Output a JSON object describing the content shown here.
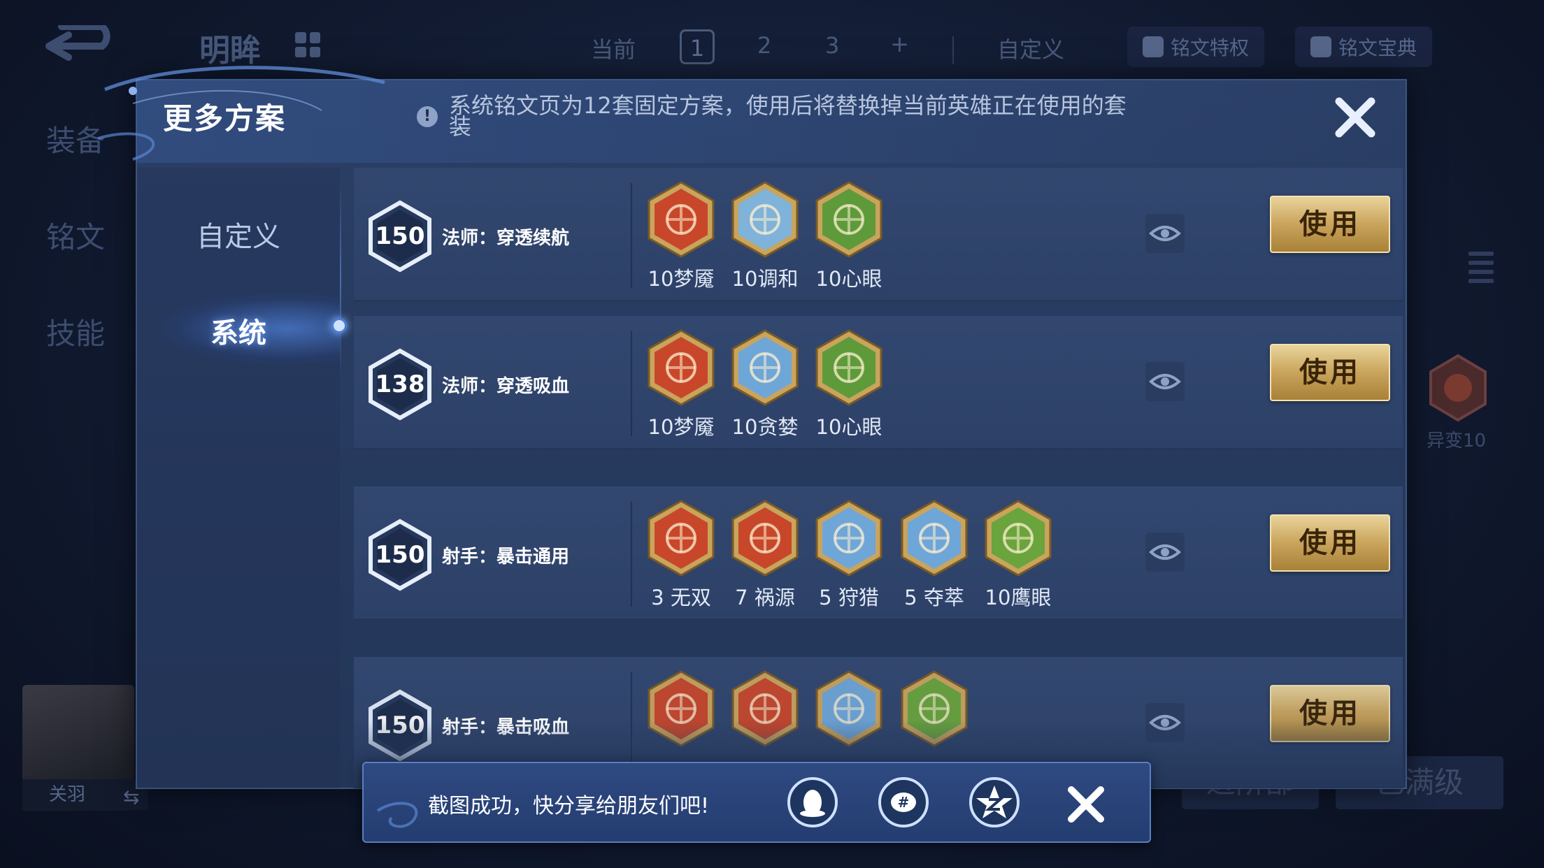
{
  "background": {
    "hero_title": "明眸",
    "current_label": "当前",
    "pages": [
      "1",
      "2",
      "3"
    ],
    "add_page": "+",
    "custom_label": "自定义",
    "rune_privilege": "铭文特权",
    "rune_codex": "铭文宝典",
    "side_tabs": [
      "装备",
      "铭文",
      "技能"
    ],
    "hero_name": "关羽",
    "bg_rune_label": "异变10",
    "bg_button_1": "进阶部",
    "bg_button_2": "已满级"
  },
  "dialog": {
    "title": "更多方案",
    "notice": "系统铭文页为12套固定方案，使用后将替换掉当前英雄正在使用的套装",
    "tabs": {
      "custom": "自定义",
      "system": "系统"
    }
  },
  "presets": [
    {
      "level": "150",
      "name": "法师：穿透续航",
      "runes": [
        {
          "label": "10梦魇",
          "color": "#c8472a",
          "icon": "red-demon-rune"
        },
        {
          "label": "10调和",
          "color": "#7fb3d9",
          "icon": "blue-drop-rune"
        },
        {
          "label": "10心眼",
          "color": "#5e9a3a",
          "icon": "green-shield-rune"
        }
      ],
      "button": "使用"
    },
    {
      "level": "138",
      "name": "法师：穿透吸血",
      "runes": [
        {
          "label": "10梦魇",
          "color": "#c8472a",
          "icon": "red-demon-rune"
        },
        {
          "label": "10贪婪",
          "color": "#6fa6d8",
          "icon": "blue-star-rune"
        },
        {
          "label": "10心眼",
          "color": "#5e9a3a",
          "icon": "green-shield-rune"
        }
      ],
      "button": "使用"
    },
    {
      "level": "150",
      "name": "射手：暴击通用",
      "runes": [
        {
          "label": "3 无双",
          "color": "#c8472a",
          "icon": "red-spiral-rune"
        },
        {
          "label": "7 祸源",
          "color": "#c8472a",
          "icon": "red-fan-rune"
        },
        {
          "label": "5 狩猎",
          "color": "#6fa6d8",
          "icon": "blue-lightning-rune"
        },
        {
          "label": "5 夺萃",
          "color": "#6fa6d8",
          "icon": "blue-knot-rune"
        },
        {
          "label": "10鹰眼",
          "color": "#6aa43c",
          "icon": "green-clover-rune"
        }
      ],
      "button": "使用"
    },
    {
      "level": "150",
      "name": "射手：暴击吸血",
      "runes": [
        {
          "label": "",
          "color": "#c8472a",
          "icon": "red-spiral-rune"
        },
        {
          "label": "",
          "color": "#c8472a",
          "icon": "red-fan-rune"
        },
        {
          "label": "",
          "color": "#6fa6d8",
          "icon": "blue-knot-rune"
        },
        {
          "label": "",
          "color": "#6aa43c",
          "icon": "green-clover-rune"
        }
      ],
      "button": "使用"
    }
  ],
  "toast": {
    "message": "截图成功，快分享给朋友们吧!",
    "share_targets": [
      "qq-icon",
      "wechat-moments-icon",
      "qzone-icon"
    ]
  },
  "colors": {
    "accent": "#c9a45c",
    "panel": "#2b3f66"
  }
}
